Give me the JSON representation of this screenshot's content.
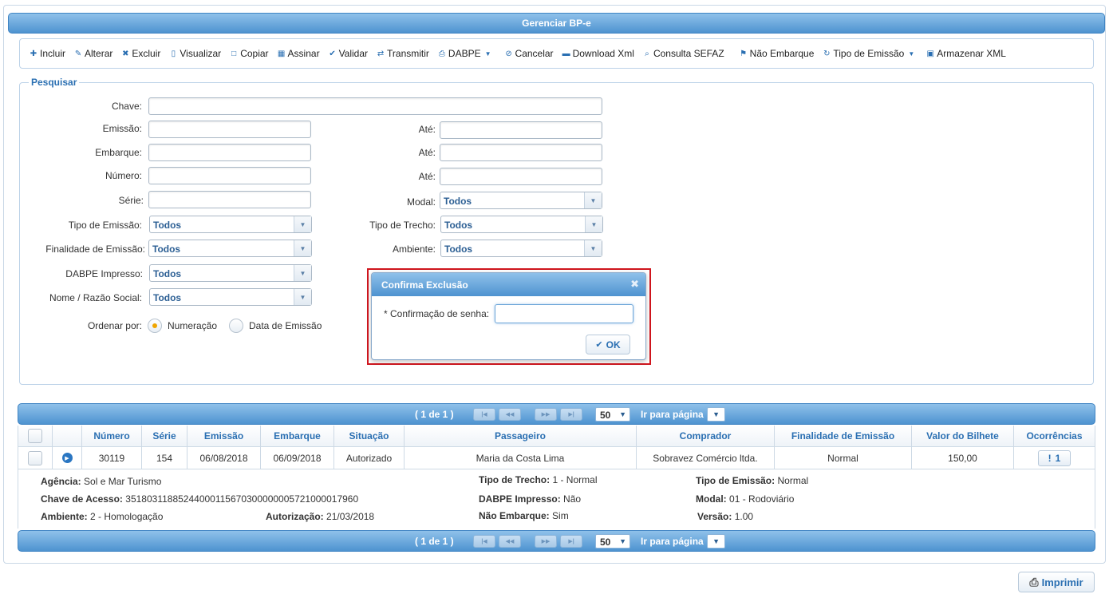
{
  "title": "Gerenciar BP-e",
  "toolbar": {
    "items": [
      {
        "icon": "plus-icon",
        "glyph": "✚",
        "label": "Incluir"
      },
      {
        "icon": "pencil-icon",
        "glyph": "✎",
        "label": "Alterar"
      },
      {
        "icon": "trash-icon",
        "glyph": "🗑",
        "label": "Excluir"
      },
      {
        "icon": "document-icon",
        "glyph": "🗋",
        "label": "Visualizar"
      },
      {
        "icon": "clipboard-icon",
        "glyph": "📋",
        "label": "Copiar"
      },
      {
        "icon": "signature-icon",
        "glyph": "▦",
        "label": "Assinar"
      },
      {
        "icon": "check-icon",
        "glyph": "✔",
        "label": "Validar"
      },
      {
        "icon": "transfer-icon",
        "glyph": "⇄",
        "label": "Transmitir"
      },
      {
        "icon": "printer-icon",
        "glyph": "⎙",
        "label": "DABPE"
      },
      {
        "icon": "cancel-icon",
        "glyph": "⊘",
        "label": "Cancelar"
      },
      {
        "icon": "folder-icon",
        "glyph": "▬",
        "label": "Download Xml"
      },
      {
        "icon": "search-icon",
        "glyph": "⌕",
        "label": "Consulta SEFAZ"
      },
      {
        "icon": "flag-icon",
        "glyph": "⚑",
        "label": "Não Embarque"
      },
      {
        "icon": "refresh-icon",
        "glyph": "↻",
        "label": "Tipo de Emissão"
      },
      {
        "icon": "save-icon",
        "glyph": "▣",
        "label": "Armazenar XML"
      }
    ]
  },
  "search": {
    "legend": "Pesquisar",
    "labels": {
      "chave": "Chave:",
      "emissao": "Emissão:",
      "embarque": "Embarque:",
      "numero": "Número:",
      "serie": "Série:",
      "ate": "Até:",
      "modal": "Modal:",
      "tipo_emissao": "Tipo de Emissão:",
      "tipo_trecho": "Tipo de Trecho:",
      "finalidade": "Finalidade de Emissão:",
      "ambiente": "Ambiente:",
      "dabpe_impresso": "DABPE Impresso:",
      "nome": "Nome / Razão Social:",
      "ordenar": "Ordenar por:"
    },
    "select_value": "Todos",
    "order_options": [
      "Numeração",
      "Data de Emissão"
    ]
  },
  "pager": {
    "info": "( 1 de 1 )",
    "page_size": "50",
    "goto_label": "Ir para página"
  },
  "table": {
    "columns": [
      "Número",
      "Série",
      "Emissão",
      "Embarque",
      "Situação",
      "Passageiro",
      "Comprador",
      "Finalidade de Emissão",
      "Valor do Bilhete",
      "Ocorrências"
    ],
    "row": {
      "numero": "30119",
      "serie": "154",
      "emissao": "06/08/2018",
      "embarque": "06/09/2018",
      "situacao": "Autorizado",
      "passageiro": "Maria da Costa Lima",
      "comprador": "Sobravez Comércio ltda.",
      "finalidade": "Normal",
      "valor": "150,00",
      "ocorrencias": "1"
    },
    "detail": {
      "agencia_lbl": "Agência:",
      "agencia": "Sol e Mar Turismo",
      "chave_lbl": "Chave de Acesso:",
      "chave": "35180311885244000115670300000005721000017960",
      "ambiente_lbl": "Ambiente:",
      "ambiente": "2 - Homologação",
      "autorizacao_lbl": "Autorização:",
      "autorizacao": "21/03/2018",
      "tipo_trecho_lbl": "Tipo de Trecho:",
      "tipo_trecho": "1 - Normal",
      "dabpe_lbl": "DABPE Impresso:",
      "dabpe": "Não",
      "nao_embarque_lbl": "Não Embarque:",
      "nao_embarque": "Sim",
      "tipo_emissao_lbl": "Tipo de Emissão:",
      "tipo_emissao": "Normal",
      "modal_lbl": "Modal:",
      "modal": "01 - Rodoviário",
      "versao_lbl": "Versão:",
      "versao": "1.00"
    }
  },
  "print_label": "Imprimir",
  "dialog": {
    "title": "Confirma Exclusão",
    "password_label": "* Confirmação de senha:",
    "password_value": "",
    "ok_label": "OK"
  },
  "colors": {
    "accent": "#4e93d0",
    "highlight": "#d0161e",
    "radio_selected": "#f0a500"
  }
}
